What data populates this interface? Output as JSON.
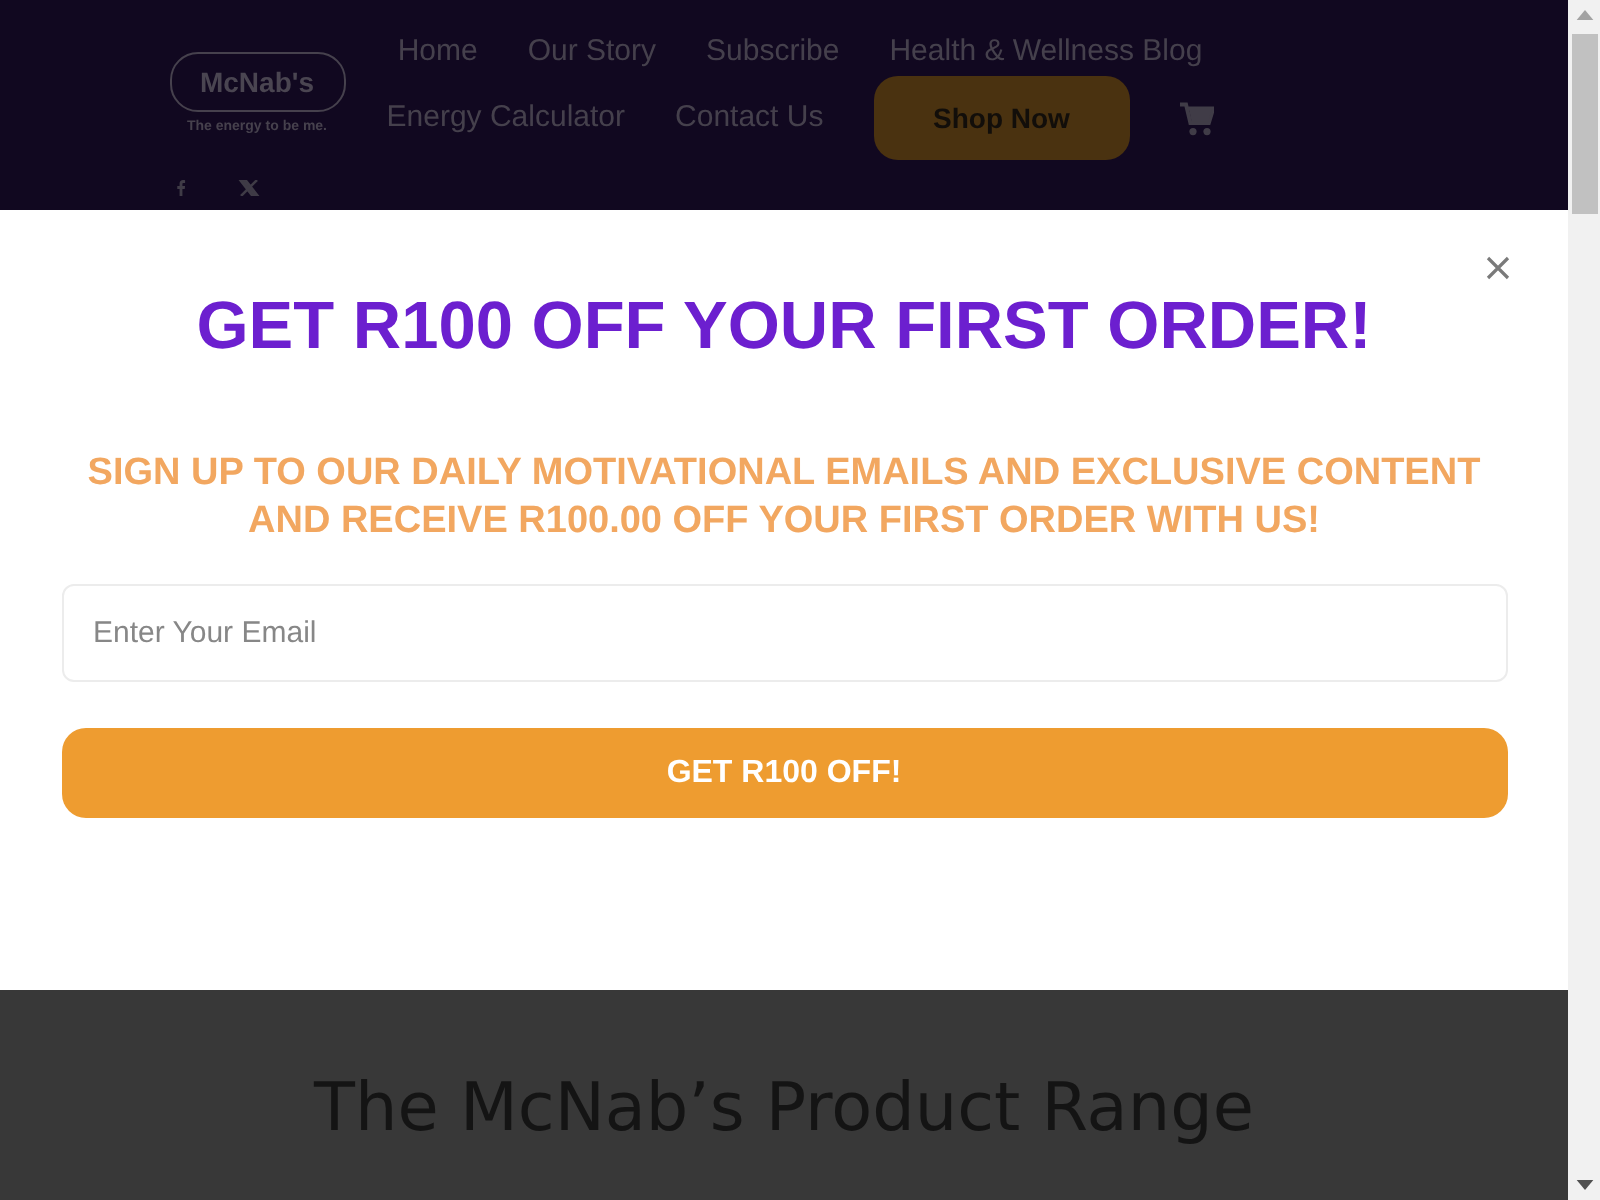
{
  "header": {
    "logo": {
      "wordmark": "McNab's",
      "tagline": "The energy to be me."
    },
    "nav": [
      {
        "label": "Home"
      },
      {
        "label": "Our Story"
      },
      {
        "label": "Subscribe"
      },
      {
        "label": "Health & Wellness Blog"
      },
      {
        "label": "Energy Calculator"
      },
      {
        "label": "Contact Us"
      }
    ],
    "shop_button": {
      "label": "Shop Now"
    }
  },
  "popup": {
    "title": "GET R100 OFF YOUR FIRST ORDER!",
    "subtitle": "SIGN UP TO OUR DAILY MOTIVATIONAL EMAILS AND EXCLUSIVE CONTENT AND RECEIVE R100.00 OFF YOUR FIRST ORDER WITH US!",
    "email_field": {
      "placeholder": "Enter Your Email"
    },
    "submit_button": {
      "label": "GET R100 OFF!"
    }
  },
  "section": {
    "heading": "The McNab’s Product Range"
  }
}
